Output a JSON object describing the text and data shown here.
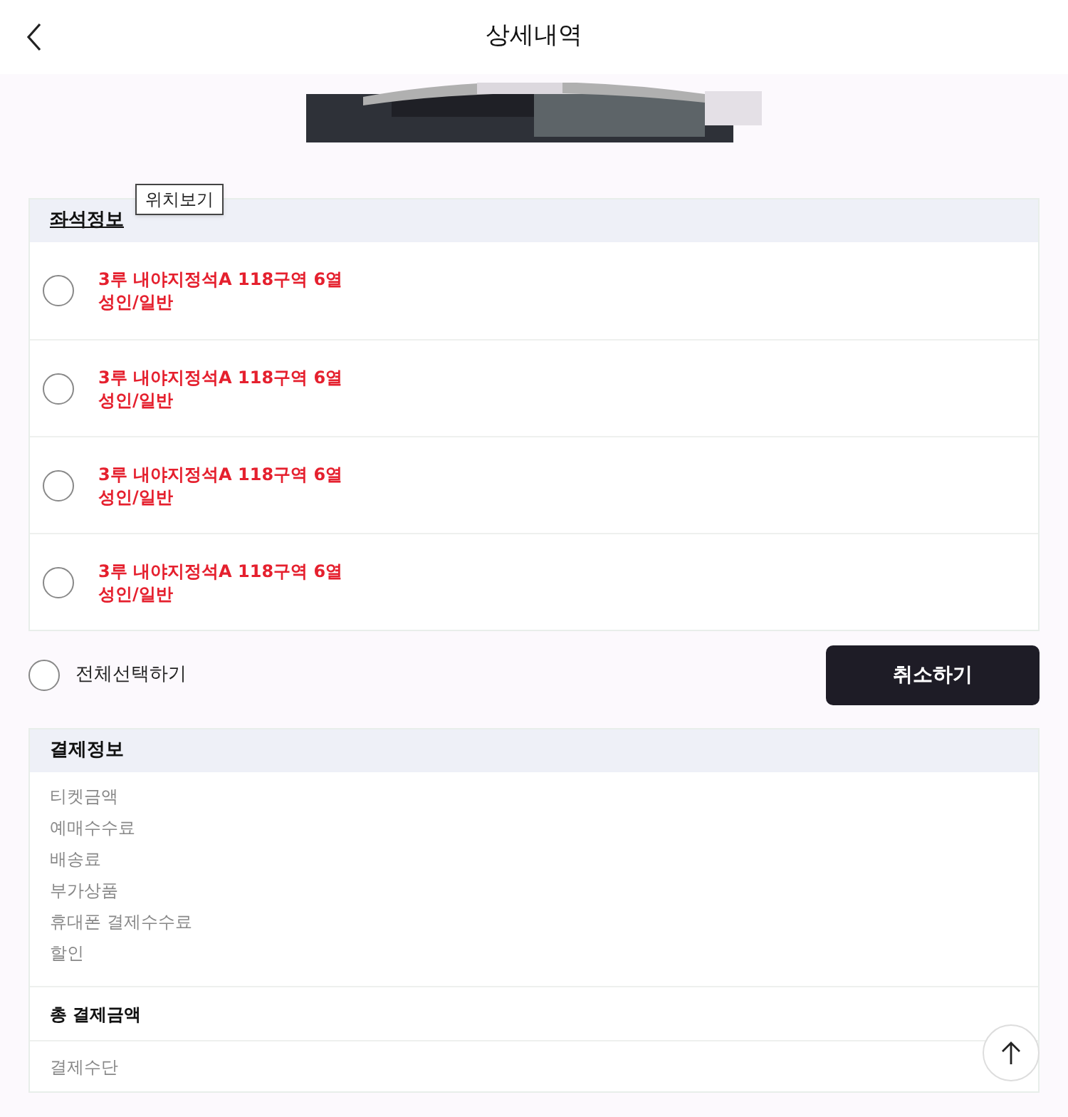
{
  "header": {
    "title": "상세내역"
  },
  "seat_info": {
    "title": "좌석정보",
    "tooltip": "위치보기",
    "seats": [
      {
        "seat": "3루 내야지정석A 118구역 6열",
        "type": "성인/일반",
        "selected": false
      },
      {
        "seat": "3루 내야지정석A 118구역 6열",
        "type": "성인/일반",
        "selected": false
      },
      {
        "seat": "3루 내야지정석A 118구역 6열",
        "type": "성인/일반",
        "selected": false
      },
      {
        "seat": "3루 내야지정석A 118구역 6열",
        "type": "성인/일반",
        "selected": false
      }
    ]
  },
  "select_all": {
    "label": "전체선택하기",
    "selected": false
  },
  "cancel_button": "취소하기",
  "payment_info": {
    "title": "결제정보",
    "items": [
      "티켓금액",
      "예매수수료",
      "배송료",
      "부가상품",
      "휴대폰 결제수수료",
      "할인"
    ],
    "total_label": "총 결제금액",
    "method_label": "결제수단"
  }
}
